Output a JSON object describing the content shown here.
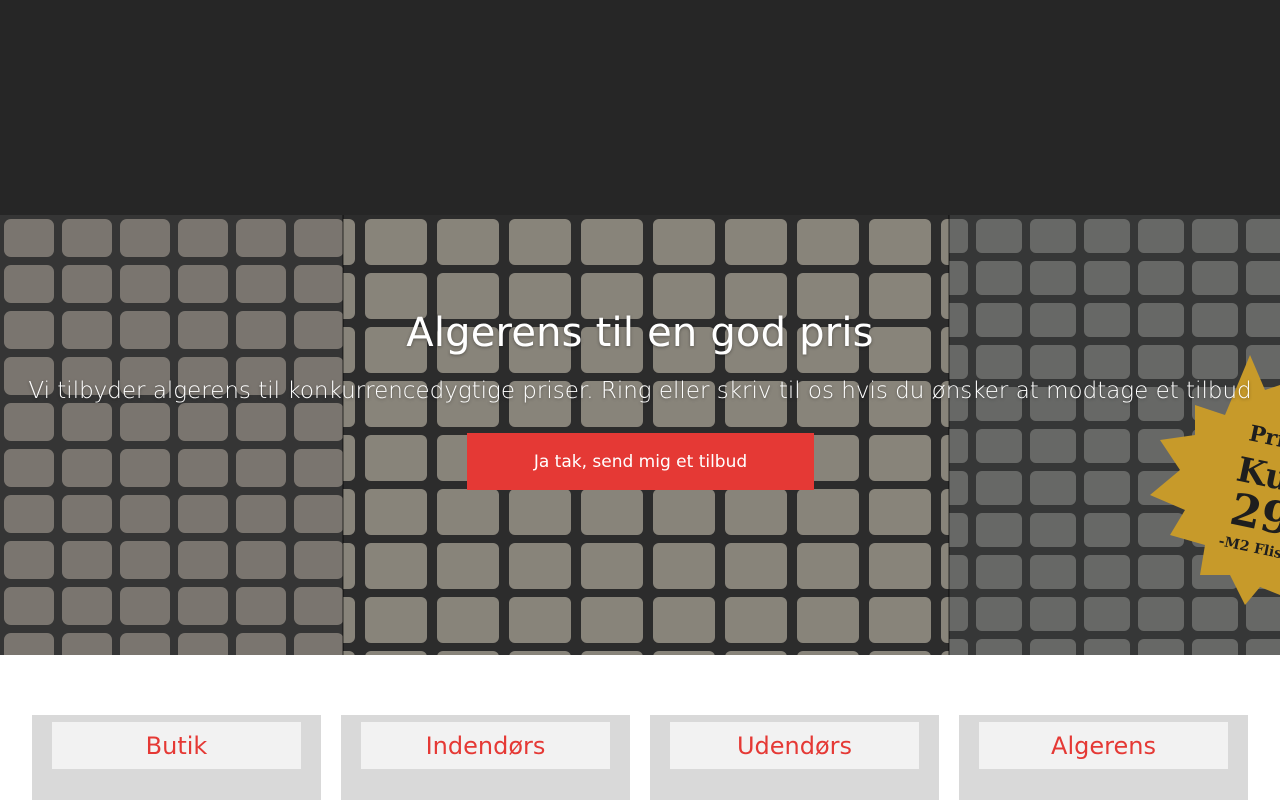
{
  "hero": {
    "title": "Algerens til en god pris",
    "subtitle": "Vi tilbyder algerens til konkurrencedygtige priser. Ring eller skriv til os hvis du ønsker at modtage et tilbud",
    "cta_label": "Ja tak, send mig et tilbud",
    "badge": {
      "line1": "Pri",
      "line2": "Ku",
      "line3": "29",
      "line4": "-M2 Flis"
    }
  },
  "categories": [
    {
      "label": "Butik"
    },
    {
      "label": "Indendørs"
    },
    {
      "label": "Udendørs"
    },
    {
      "label": "Algerens"
    }
  ],
  "colors": {
    "header_bg": "#262626",
    "accent": "#e53935",
    "badge": "#c79a2a",
    "card_bg": "#d9d9d9"
  }
}
